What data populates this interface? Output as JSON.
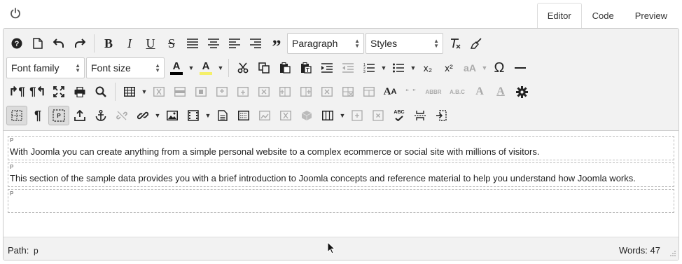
{
  "top": {
    "power_icon": "power-icon",
    "tabs": [
      {
        "label": "Editor",
        "active": true
      },
      {
        "label": "Code",
        "active": false
      },
      {
        "label": "Preview",
        "active": false
      }
    ]
  },
  "toolbar": {
    "block_format": "Paragraph",
    "styles": "Styles",
    "font_family": "Font family",
    "font_size": "Font size",
    "font_color_letter": "A",
    "bg_color_letter": "A",
    "font_color_hex": "#000000",
    "bg_color_hex": "#f5f06a",
    "subscript": "x₂",
    "superscript": "x²",
    "changecase": "aA",
    "omega": "Ω",
    "quote_marks": "“ ”",
    "abbr": "ABBR",
    "acronym": "A.B.C",
    "spellcheck": "ABC"
  },
  "content": {
    "paragraphs": [
      {
        "tag": "P",
        "text": "With Joomla you can create anything from a simple personal website to a complex ecommerce or social site with millions of visitors."
      },
      {
        "tag": "P",
        "text": "This section of the sample data provides you with a brief introduction to Joomla concepts and reference material to help you understand how Joomla works."
      },
      {
        "tag": "P",
        "text": ""
      }
    ]
  },
  "status": {
    "path_label": "Path:",
    "path_value": "p",
    "words": "Words: 47"
  }
}
